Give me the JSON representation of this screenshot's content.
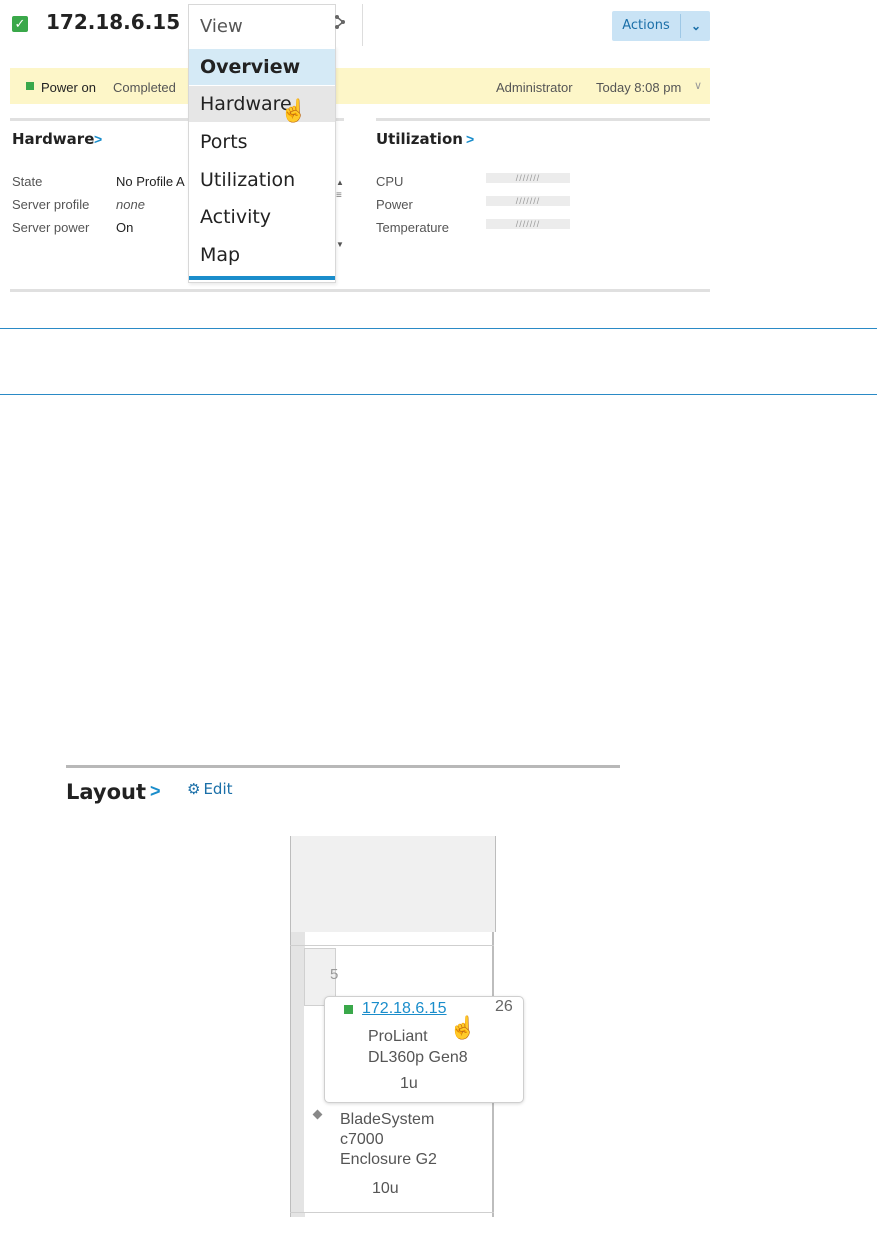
{
  "header": {
    "title": "172.18.6.15",
    "view_label": "View",
    "actions_label": "Actions",
    "share_icon": "share-icon",
    "status_icon": "checkbox-icon"
  },
  "status_bar": {
    "state": "Power on",
    "result": "Completed",
    "user": "Administrator",
    "time": "Today 8:08 pm"
  },
  "view_menu": {
    "items": [
      "Overview",
      "Hardware",
      "Ports",
      "Utilization",
      "Activity",
      "Map"
    ],
    "active": "Overview",
    "hovered": "Hardware"
  },
  "hardware": {
    "title": "Hardware",
    "arrow": ">",
    "fields": [
      {
        "label": "State",
        "value": "No Profile A"
      },
      {
        "label": "Server profile",
        "value": "none"
      },
      {
        "label": "Server power",
        "value": "On"
      }
    ]
  },
  "utilization": {
    "title": "Utilization",
    "arrow": ">",
    "fields": [
      {
        "label": "CPU",
        "bar": "///////"
      },
      {
        "label": "Power",
        "bar": "///////"
      },
      {
        "label": "Temperature",
        "bar": "///////"
      }
    ]
  },
  "layout": {
    "title": "Layout",
    "arrow": ">",
    "edit_label": "Edit",
    "slot_number": "5",
    "enclosure": {
      "line1": "BladeSystem",
      "line2": "c7000",
      "line3": "Enclosure G2",
      "size": "10u"
    },
    "tooltip": {
      "link": "172.18.6.15",
      "position": "26",
      "line1": "ProLiant",
      "line2": "DL360p Gen8",
      "size": "1u"
    }
  },
  "colors": {
    "accent": "#1a8dcb",
    "status_ok": "#3aa84a",
    "status_bar_bg": "#fdf6c8"
  }
}
